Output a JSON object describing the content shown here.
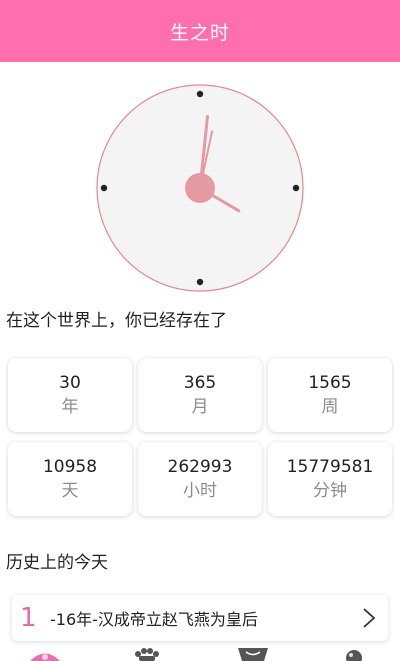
{
  "header": {
    "title": "生之时"
  },
  "clock": {
    "face_color": "#f4f4f4",
    "rim_color": "#e2898f",
    "hand_color": "#e59aa2",
    "hour": 4,
    "minute": 1,
    "second": 2
  },
  "intro": {
    "label": "在这个世界上，你已经存在了"
  },
  "stats": [
    {
      "value": "30",
      "unit": "年"
    },
    {
      "value": "365",
      "unit": "月"
    },
    {
      "value": "1565",
      "unit": "周"
    },
    {
      "value": "10958",
      "unit": "天"
    },
    {
      "value": "262993",
      "unit": "小时"
    },
    {
      "value": "15779581",
      "unit": "分钟"
    }
  ],
  "history": {
    "label": "历史上的今天",
    "items": [
      {
        "index": "1",
        "text": "-16年-汉成帝立赵飞燕为皇后"
      }
    ]
  },
  "bottom_nav": {
    "icons": [
      "home-icon",
      "paw-icon",
      "cup-icon",
      "drop-icon"
    ]
  },
  "colors": {
    "primary": "#ff6fae",
    "accent": "#e76aa8"
  }
}
